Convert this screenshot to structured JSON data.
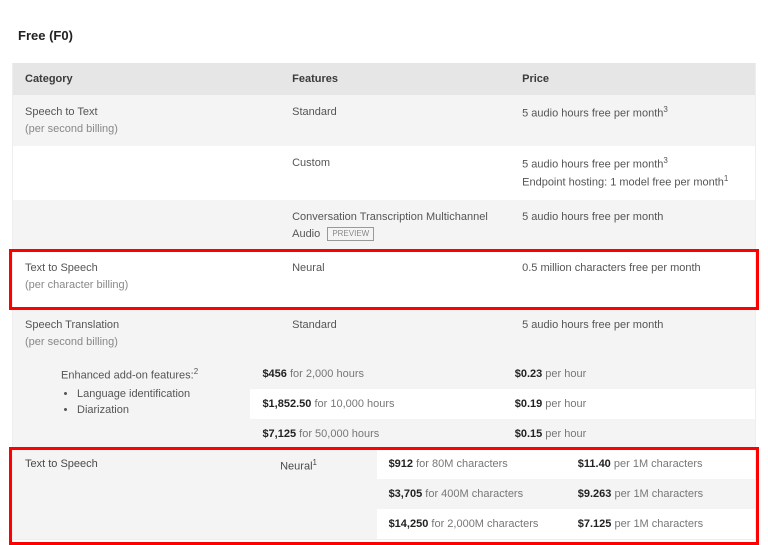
{
  "tier": "Free (F0)",
  "headers": {
    "category": "Category",
    "features": "Features",
    "price": "Price"
  },
  "rows": {
    "stt": {
      "cat": "Speech to Text",
      "sub": "(per second billing)",
      "r1f": "Standard",
      "r1p": "5 audio hours free per month",
      "r2f": "Custom",
      "r2p1": "5 audio hours free per month",
      "r2p2": "Endpoint hosting: 1 model free per month",
      "r3f": "Conversation Transcription Multichannel Audio",
      "r3badge": "PREVIEW",
      "r3p": "5 audio hours free per month"
    },
    "tts": {
      "cat": "Text to Speech",
      "sub": "(per character billing)",
      "f": "Neural",
      "p": "0.5 million characters free per month"
    },
    "trans": {
      "cat": "Speech Translation",
      "sub": "(per second billing)",
      "f": "Standard",
      "p": "5 audio hours free per month"
    },
    "addon": {
      "title": "Enhanced add-on features:",
      "b1": "Language identification",
      "b2": "Diarization",
      "p": [
        {
          "amt": "$456",
          "for": "for 2,000 hours",
          "rate": "$0.23",
          "unit": "per hour"
        },
        {
          "amt": "$1,852.50",
          "for": "for 10,000 hours",
          "rate": "$0.19",
          "unit": "per hour"
        },
        {
          "amt": "$7,125",
          "for": "for 50,000 hours",
          "rate": "$0.15",
          "unit": "per hour"
        }
      ]
    },
    "tts2": {
      "cat": "Text to Speech",
      "f": "Neural",
      "p": [
        {
          "amt": "$912",
          "for": "for 80M characters",
          "rate": "$11.40",
          "unit": "per 1M characters"
        },
        {
          "amt": "$3,705",
          "for": "for 400M characters",
          "rate": "$9.263",
          "unit": "per 1M characters"
        },
        {
          "amt": "$14,250",
          "for": "for 2,000M characters",
          "rate": "$7.125",
          "unit": "per 1M characters"
        }
      ]
    }
  }
}
